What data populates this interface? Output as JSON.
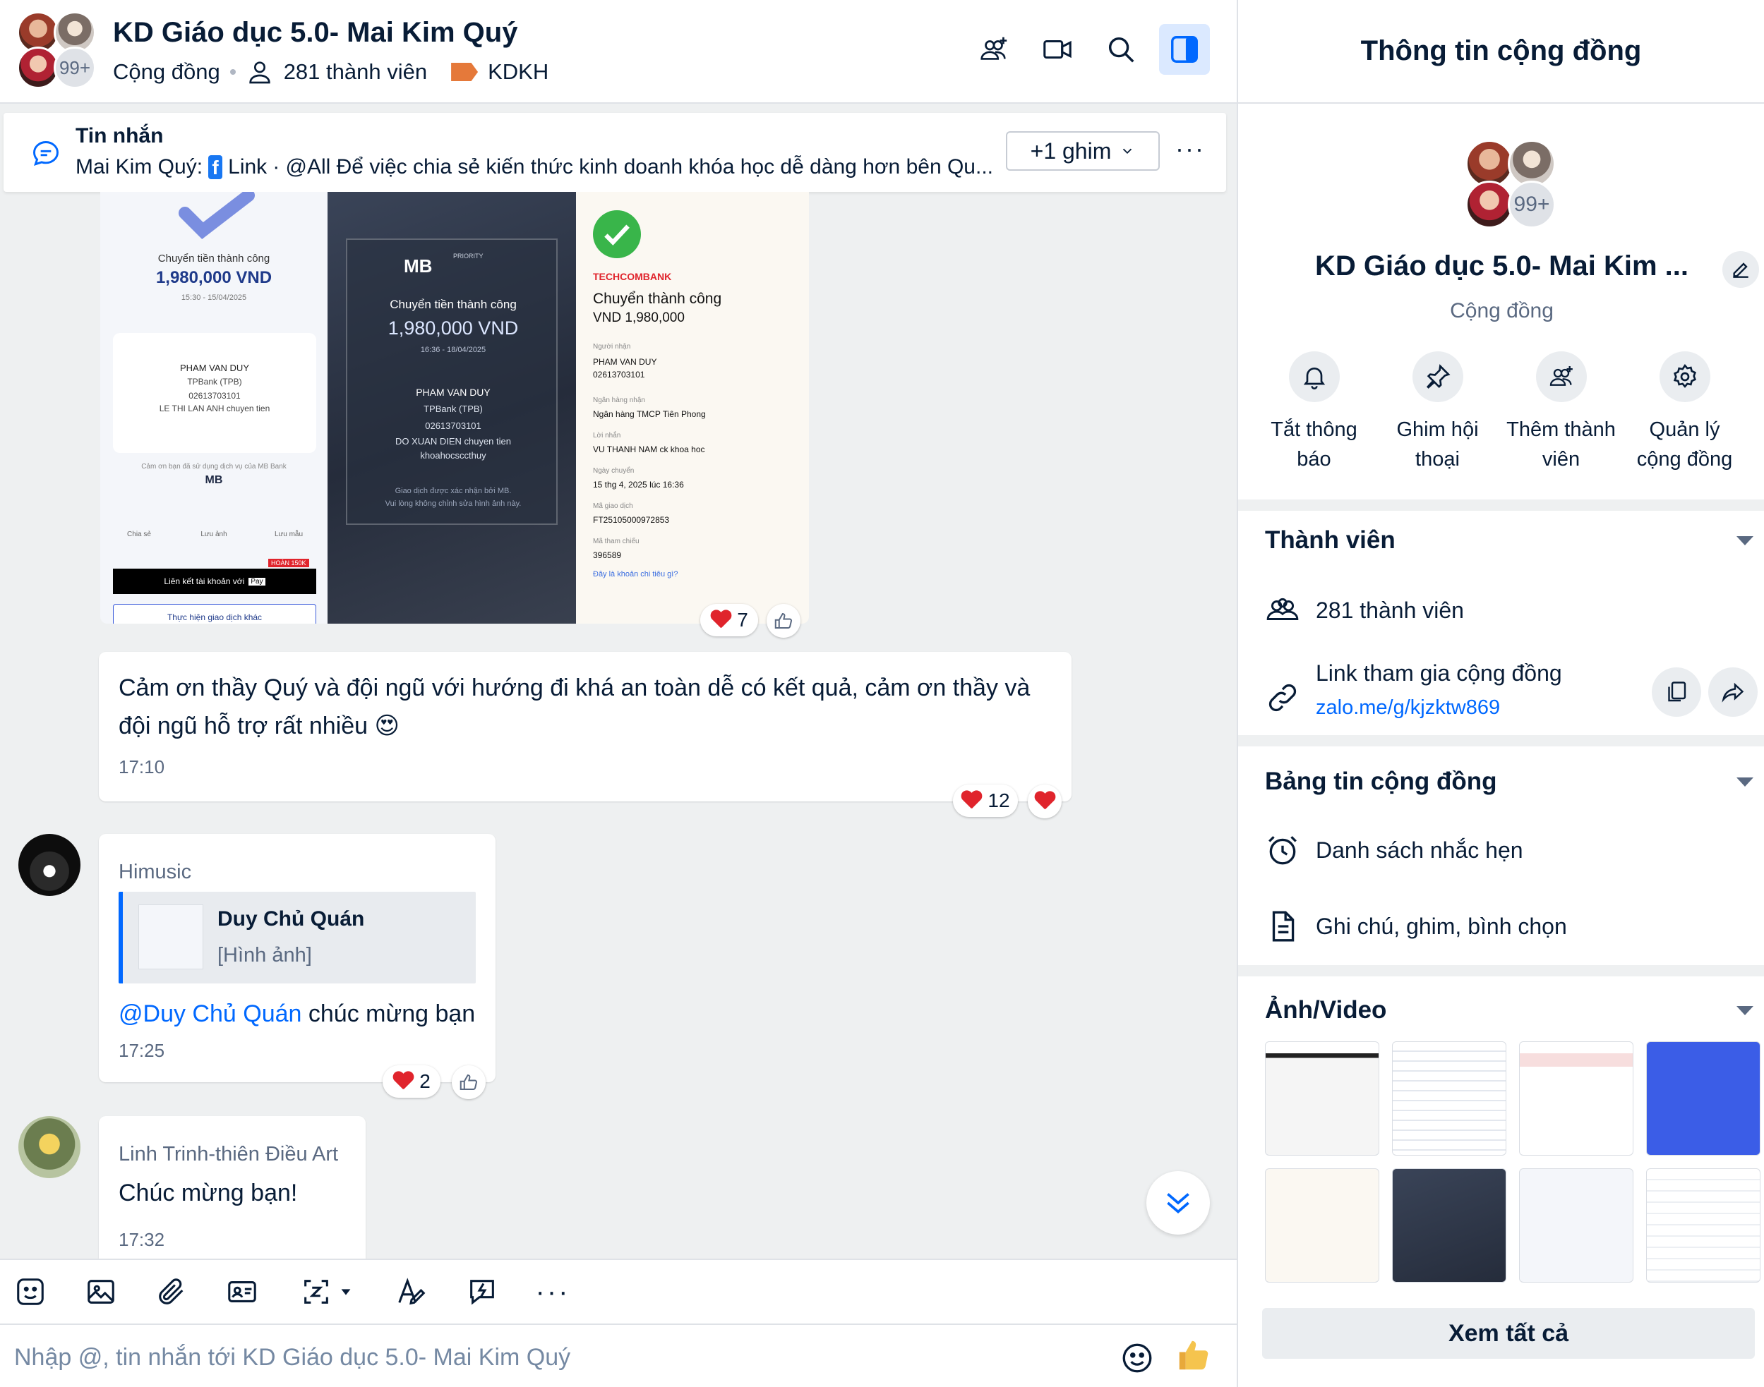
{
  "header": {
    "title": "KD Giáo dục 5.0- Mai Kim Quý",
    "type": "Cộng đồng",
    "members": "281 thành viên",
    "tag": "KDKH",
    "avatar_more": "99+",
    "tag_color": "#e5793a"
  },
  "pinned": {
    "title": "Tin nhắn",
    "text_sender": "Mai Kim Quý:",
    "text_link": "Link",
    "text_body": "· @All  Để việc chia sẻ kiến thức kinh doanh khóa học dễ dàng hơn bên Qu...",
    "ghim_label": "+1 ghim",
    "more": "···"
  },
  "receipts": {
    "r1": {
      "title": "Chuyển tiền thành công",
      "amount": "1,980,000 VND",
      "datetime": "15:30 - 15/04/2025",
      "receiver": "PHAM VAN DUY",
      "bank": "TPBank (TPB)",
      "account": "02613703101",
      "note": "LE THI LAN ANH chuyen tien",
      "thanks": "Cảm ơn bạn đã sử dụng dịch vụ của MB Bank",
      "logo": "MB",
      "share": "Chia sẻ",
      "save_img": "Lưu ảnh",
      "save_tpl": "Lưu mẫu",
      "promo": "HOÀN 150K",
      "link_btn": "Liên kết tài khoản với",
      "pay": "Pay",
      "other_btn": "Thực hiện giao dịch khác"
    },
    "r2": {
      "logo": "MB",
      "priority": "PRIORITY",
      "title": "Chuyển tiền thành công",
      "amount": "1,980,000 VND",
      "datetime": "16:36 - 18/04/2025",
      "receiver": "PHAM VAN DUY",
      "bank": "TPBank (TPB)",
      "account": "02613703101",
      "note1": "DO XUAN DIEN chuyen tien",
      "note2": "khoahocsccthuy",
      "footer1": "Giao dịch được xác nhận bởi MB.",
      "footer2": "Vui lòng không chỉnh sửa hình ảnh này."
    },
    "r3": {
      "bank": "TECHCOMBANK",
      "title": "Chuyển thành công",
      "amount": "VND 1,980,000",
      "l1": "Người nhận",
      "v1a": "PHAM VAN DUY",
      "v1b": "02613703101",
      "l2": "Ngân hàng nhận",
      "v2": "Ngân hàng TMCP Tiên Phong",
      "l3": "Lời nhắn",
      "v3": "VU THANH NAM ck khoa hoc",
      "l4": "Ngày chuyển",
      "v4": "15 thg 4, 2025 lúc 16:36",
      "l5": "Mã giao dịch",
      "v5": "FT25105000972853",
      "l6": "Mã tham chiếu",
      "v6": "396589",
      "link": "Đây là khoản chi tiêu gì?"
    },
    "react_count": "7"
  },
  "messages": [
    {
      "text": "Cảm ơn thầy Quý và đội ngũ với hướng đi khá an toàn dễ có kết quả, cảm ơn thầy và đội ngũ hỗ trợ rất nhiều 😍",
      "time": "17:10",
      "react_count": "12"
    },
    {
      "sender": "Himusic",
      "quote_name": "Duy Chủ Quán",
      "quote_type": "[Hình ảnh]",
      "mention": "@Duy Chủ Quán",
      "text": "chúc mừng bạn",
      "time": "17:25",
      "react_count": "2"
    },
    {
      "sender": "Linh Trinh-thiên Điều Art",
      "text": "Chúc mừng bạn!",
      "time": "17:32"
    }
  ],
  "composer": {
    "placeholder": "Nhập @, tin nhắn tới KD Giáo dục 5.0- Mai Kim Quý",
    "more": "···"
  },
  "panel": {
    "title": "Thông tin cộng đồng",
    "name": "KD Giáo dục 5.0- Mai Kim ...",
    "type": "Cộng đồng",
    "avatar_more": "99+",
    "actions": [
      {
        "label": "Tắt thông báo",
        "icon": "bell-icon"
      },
      {
        "label": "Ghim hội thoại",
        "icon": "pin-icon"
      },
      {
        "label": "Thêm thành viên",
        "icon": "add-member-icon"
      },
      {
        "label": "Quản lý cộng đồng",
        "icon": "gear-icon"
      }
    ],
    "members_section": {
      "title": "Thành viên",
      "count": "281 thành viên",
      "link_label": "Link tham gia cộng đồng",
      "link": "zalo.me/g/kjzktw869"
    },
    "board_section": {
      "title": "Bảng tin cộng đồng",
      "items": [
        "Danh sách nhắc hẹn",
        "Ghi chú, ghim, bình chọn"
      ]
    },
    "media_section": {
      "title": "Ảnh/Video",
      "see_all": "Xem tất cả"
    }
  },
  "colors": {
    "accent": "#0068ff",
    "text": "#081c36",
    "secondary": "#5a6981",
    "heart": "#e0242c"
  }
}
